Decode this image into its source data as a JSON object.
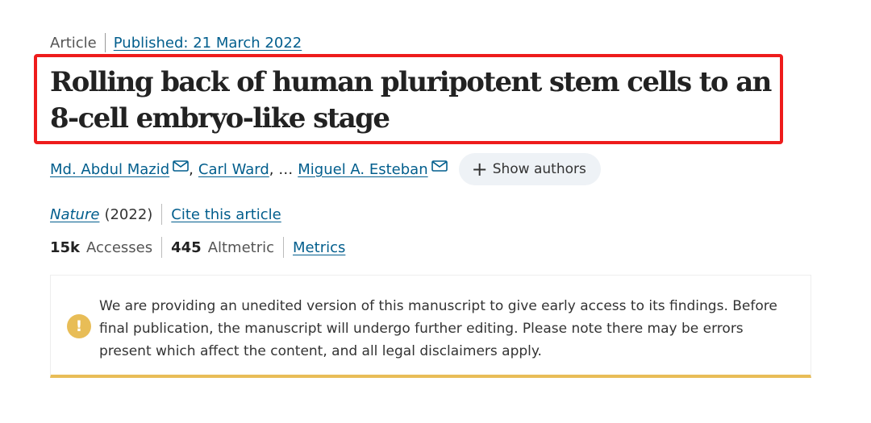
{
  "article": {
    "type_label": "Article",
    "published": "Published: 21 March 2022",
    "title": "Rolling back of human pluripotent stem cells to an 8-cell embryo-like stage"
  },
  "authors": {
    "list": [
      "Md. Abdul Mazid",
      "Carl Ward",
      "Miguel A. Esteban"
    ],
    "separator": ",",
    "ellipsis": ", …",
    "show_authors_label": "Show authors",
    "show_authors_icon": "plus-icon",
    "mail_icon": "envelope-icon"
  },
  "journal": {
    "name": "Nature",
    "year": "(2022)",
    "cite_label": "Cite this article"
  },
  "stats": {
    "accesses_value": "15k",
    "accesses_label": "Accesses",
    "altmetric_value": "445",
    "altmetric_label": "Altmetric",
    "metrics_label": "Metrics"
  },
  "notice": {
    "icon": "exclamation-icon",
    "text": "We are providing an unedited version of this manuscript to give early access to its findings. Before final publication, the manuscript will undergo further editing. Please note there may be errors present which affect the content, and all legal disclaimers apply."
  },
  "colors": {
    "link": "#025e8d",
    "highlight_box": "#ee1c1c",
    "notice_accent": "#e8bd57"
  }
}
